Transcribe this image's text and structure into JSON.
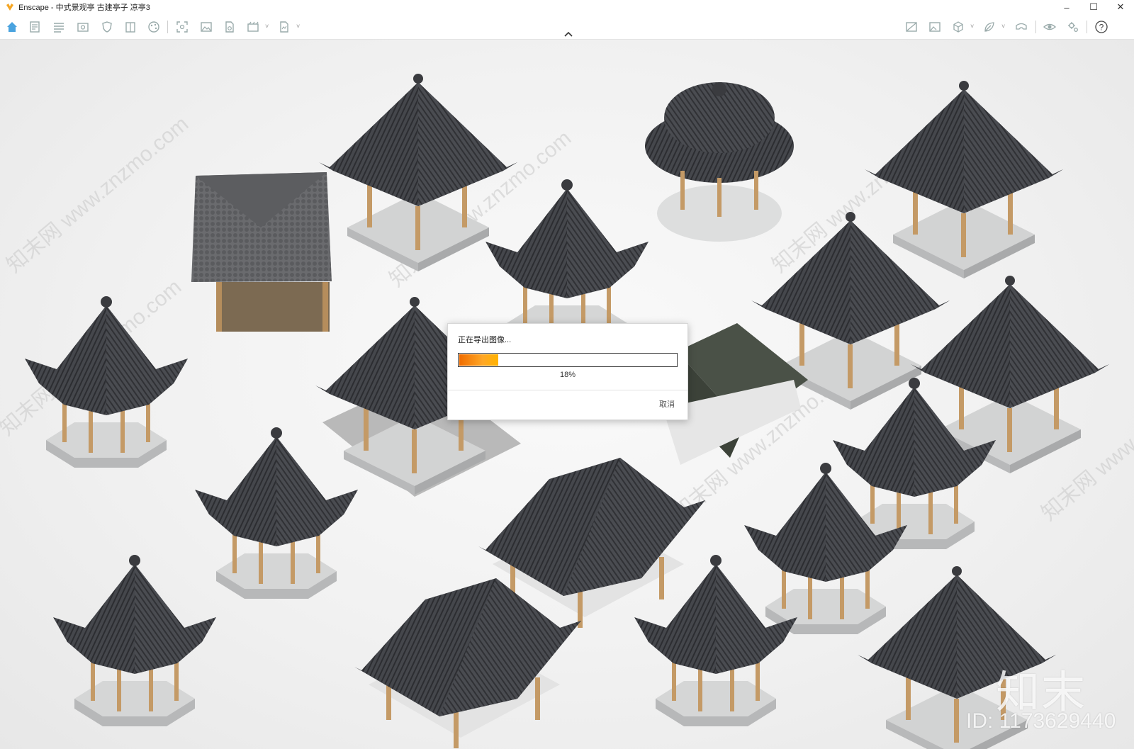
{
  "window": {
    "title": "Enscape - 中式景观亭 古建亭子 凉亭3",
    "controls": {
      "minimize": "–",
      "maximize": "☐",
      "close": "✕"
    }
  },
  "toolbar": {
    "left_icons": [
      "home-icon",
      "batch-icon",
      "list-icon",
      "view-icon",
      "shield-icon",
      "book-icon",
      "palette-icon",
      "screenshot-icon",
      "image-icon",
      "export-file-icon",
      "batch-render-icon",
      "panorama-icon"
    ],
    "right_icons": [
      "no-render-icon",
      "gallery-icon",
      "cube-icon",
      "leaf-icon",
      "vr-icon",
      "eye-icon",
      "settings-icon",
      "help-icon"
    ],
    "help_label": "?"
  },
  "export_dialog": {
    "title": "正在导出图像...",
    "progress": 0.18,
    "percent_label": "18%",
    "cancel_label": "取消"
  },
  "watermark": {
    "repeat_text": "知末网 www.znzmo.com",
    "logo_text": "知末",
    "id_text": "ID: 1173629440"
  },
  "colors": {
    "roof": "#3d3f44",
    "wood": "#c49a66",
    "stone": "#cfd0d0",
    "accent": "#ef6c00",
    "brand_logo": "#f5a623"
  }
}
